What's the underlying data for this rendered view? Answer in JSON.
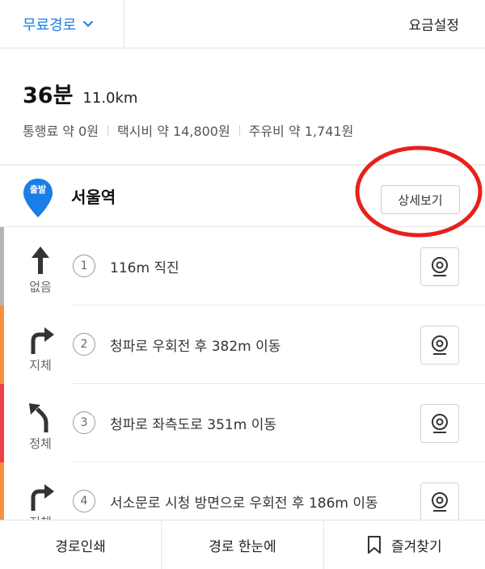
{
  "topbar": {
    "route_option": "무료경로",
    "fare_setting": "요금설정"
  },
  "summary": {
    "duration": "36분",
    "distance": "11.0km",
    "toll": "통행료 약 0원",
    "taxi": "택시비 약 14,800원",
    "fuel": "주유비 약 1,741원"
  },
  "start": {
    "pin_label": "출발",
    "name": "서울역",
    "detail_button": "상세보기"
  },
  "steps": [
    {
      "num": "1",
      "text": "116m 직진",
      "traffic": "없음",
      "traffic_color": "#b5b5b5",
      "turn": "straight-arrow-icon"
    },
    {
      "num": "2",
      "text": "청파로 우회전 후 382m 이동",
      "traffic": "지체",
      "traffic_color": "#f5913a",
      "turn": "turn-right-arrow-icon"
    },
    {
      "num": "3",
      "text": "청파로 좌측도로 351m 이동",
      "traffic": "정체",
      "traffic_color": "#ee3d4b",
      "turn": "keep-left-arrow-icon"
    },
    {
      "num": "4",
      "text": "서소문로 시청 방면으로 우회전 후 186m 이동",
      "traffic": "지체",
      "traffic_color": "#f5913a",
      "turn": "turn-right-arrow-icon"
    }
  ],
  "bottombar": {
    "print": "경로인쇄",
    "overview": "경로 한눈에",
    "favorite": "즐겨찾기"
  },
  "colors": {
    "accent_blue": "#1a7ee6",
    "annotation_red": "#e8201c"
  }
}
